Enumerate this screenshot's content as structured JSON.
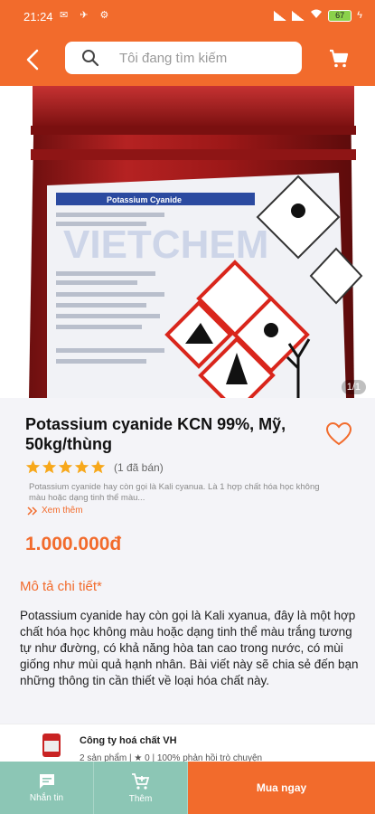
{
  "status_bar": {
    "time": "21:24",
    "battery": "67"
  },
  "header": {
    "search_placeholder": "Tôi đang tìm kiếm"
  },
  "product_image": {
    "label_text": "Potassium Cyanide",
    "watermark": "VIETCHEM",
    "counter": "1/1"
  },
  "product": {
    "title": "Potassium cyanide KCN 99%, Mỹ, 50kg/thùng",
    "rating": 5,
    "sold": "(1 đã bán)",
    "short_desc": "Potassium cyanide hay còn gọi là Kali cyanua. Là 1 hợp chất hóa học không màu hoặc dạng tinh thể màu...",
    "see_more": "Xem thêm",
    "price": "1.000.000đ",
    "detail_heading": "Mô tả chi tiết*",
    "detail_text": "Potassium cyanide hay còn gọi là Kali xyanua, đây là một hợp chất hóa học không màu hoặc dạng tinh thể màu trắng tương tự như đường, có khả năng hòa tan cao trong nước, có mùi giống như mùi quả hạnh nhân. Bài viết này sẽ chia sẻ đến bạn những thông tin cần thiết về loại hóa chất này."
  },
  "seller": {
    "name": "Công ty hoá chất VH",
    "meta": "2 sản phẩm | ★ 0 | 100% phản hồi trò chuyện"
  },
  "bottom_bar": {
    "message_label": "Nhắn tin",
    "add_label": "Thêm",
    "buy_label": "Mua ngay"
  },
  "colors": {
    "accent": "#f26b2c",
    "bottom_teal": "#8cc6b5"
  }
}
